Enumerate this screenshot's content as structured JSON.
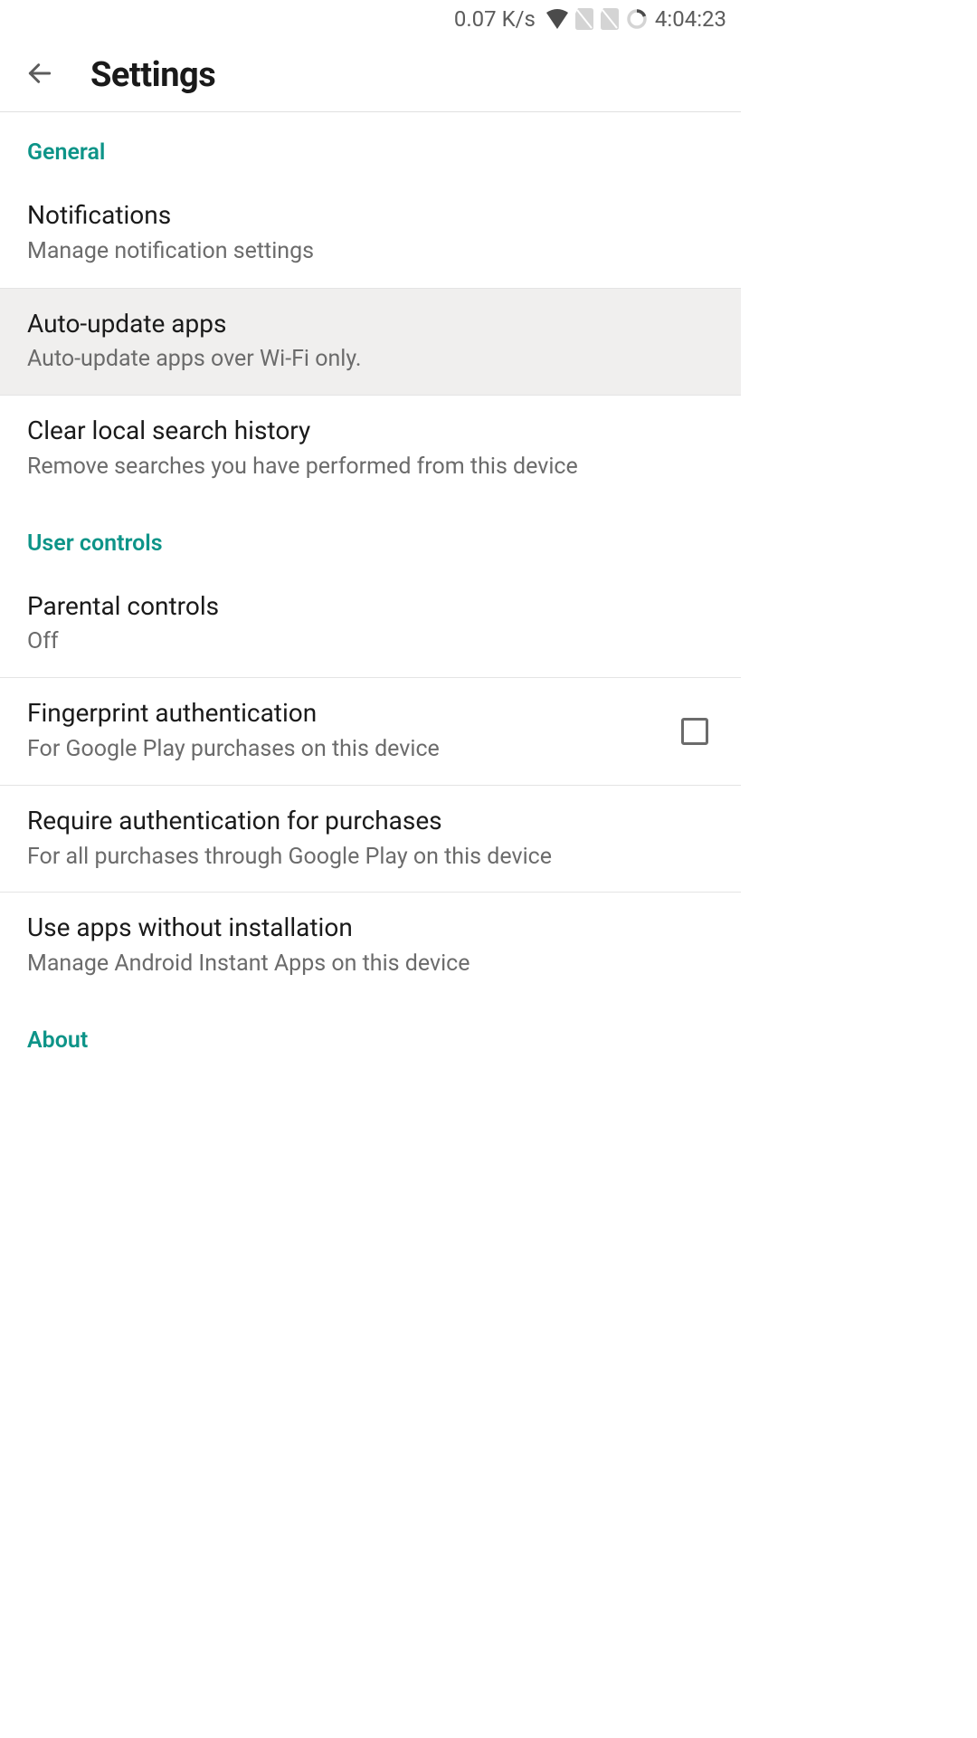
{
  "status_bar": {
    "speed": "0.07 K/s",
    "time": "4:04:23"
  },
  "app_bar": {
    "title": "Settings"
  },
  "sections": {
    "general": {
      "header": "General",
      "items": {
        "notifications": {
          "title": "Notifications",
          "subtitle": "Manage notification settings"
        },
        "auto_update": {
          "title": "Auto-update apps",
          "subtitle": "Auto-update apps over Wi-Fi only."
        },
        "clear_history": {
          "title": "Clear local search history",
          "subtitle": "Remove searches you have performed from this device"
        }
      }
    },
    "user_controls": {
      "header": "User controls",
      "items": {
        "parental": {
          "title": "Parental controls",
          "subtitle": "Off"
        },
        "fingerprint": {
          "title": "Fingerprint authentication",
          "subtitle": "For Google Play purchases on this device",
          "checked": false
        },
        "require_auth": {
          "title": "Require authentication for purchases",
          "subtitle": "For all purchases through Google Play on this device"
        },
        "instant_apps": {
          "title": "Use apps without installation",
          "subtitle": "Manage Android Instant Apps on this device"
        }
      }
    },
    "about": {
      "header": "About"
    }
  }
}
